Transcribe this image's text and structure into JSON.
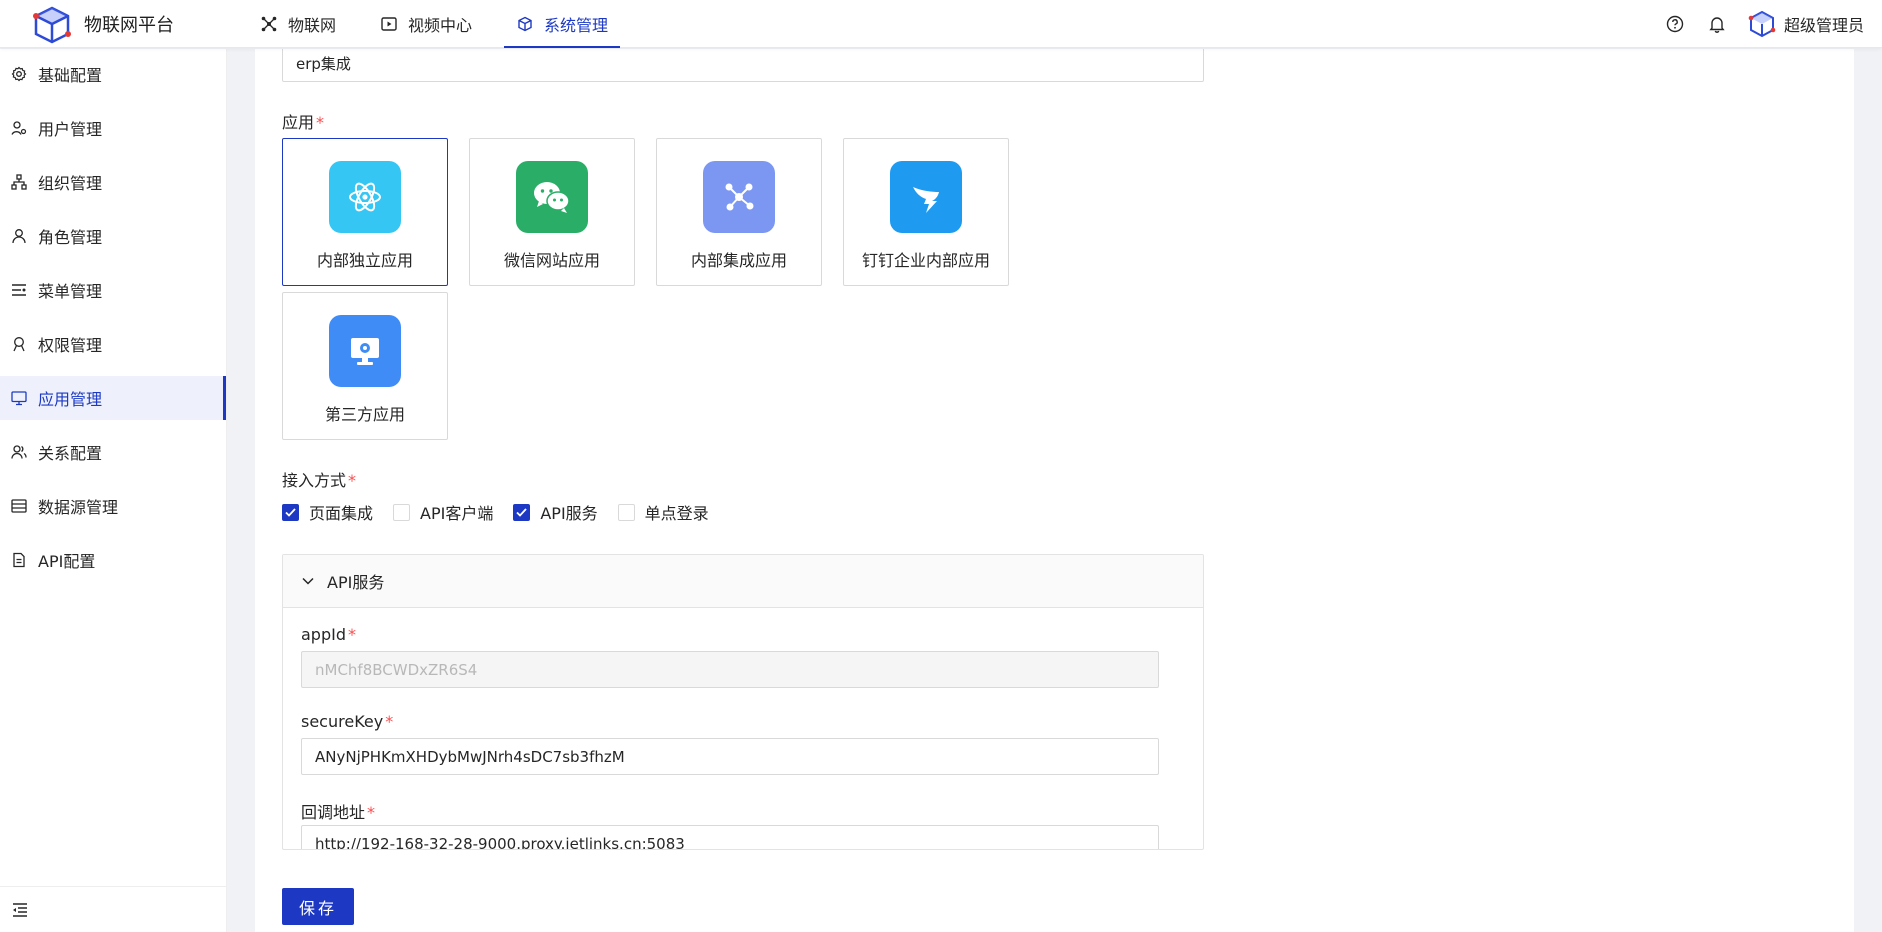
{
  "header": {
    "app_title": "物联网平台",
    "nav": [
      {
        "label": "物联网",
        "icon": "iot-icon"
      },
      {
        "label": "视频中心",
        "icon": "video-icon"
      },
      {
        "label": "系统管理",
        "icon": "system-icon",
        "active": true
      }
    ],
    "user_name": "超级管理员"
  },
  "sidebar": {
    "items": [
      {
        "label": "基础配置",
        "icon": "gear-icon"
      },
      {
        "label": "用户管理",
        "icon": "user-manage-icon"
      },
      {
        "label": "组织管理",
        "icon": "org-icon"
      },
      {
        "label": "角色管理",
        "icon": "role-icon"
      },
      {
        "label": "菜单管理",
        "icon": "menu-icon"
      },
      {
        "label": "权限管理",
        "icon": "permission-icon"
      },
      {
        "label": "应用管理",
        "icon": "app-manage-icon",
        "active": true
      },
      {
        "label": "关系配置",
        "icon": "relation-icon"
      },
      {
        "label": "数据源管理",
        "icon": "datasource-icon"
      },
      {
        "label": "API配置",
        "icon": "api-config-icon"
      }
    ]
  },
  "form": {
    "name_value": "erp集成",
    "app_label": "应用",
    "app_cards": [
      {
        "label": "内部独立应用",
        "icon": "atom-icon",
        "color": "#36c6f4",
        "selected": true
      },
      {
        "label": "微信网站应用",
        "icon": "wechat-icon",
        "color": "#2aae67"
      },
      {
        "label": "内部集成应用",
        "icon": "network-icon",
        "color": "#7b97f2"
      },
      {
        "label": "钉钉企业内部应用",
        "icon": "dingtalk-icon",
        "color": "#1e9bf0"
      },
      {
        "label": "第三方应用",
        "icon": "monitor-gear-icon",
        "color": "#3f8cf7"
      }
    ],
    "access_label": "接入方式",
    "access_options": [
      {
        "label": "页面集成",
        "checked": true
      },
      {
        "label": "API客户端",
        "checked": false
      },
      {
        "label": "API服务",
        "checked": true
      },
      {
        "label": "单点登录",
        "checked": false
      }
    ],
    "api_panel": {
      "title": "API服务",
      "appid_label": "appId",
      "appid_value": "nMChf8BCWDxZR6S4",
      "securekey_label": "secureKey",
      "securekey_value": "ANyNjPHKmXHDybMwJNrh4sDC7sb3fhzM",
      "callback_label": "回调地址",
      "callback_value": "http://192-168-32-28-9000.proxy.jetlinks.cn:5083"
    },
    "save_label": "保存"
  },
  "colors": {
    "primary": "#1d39c4",
    "required": "#ff4d4f"
  }
}
